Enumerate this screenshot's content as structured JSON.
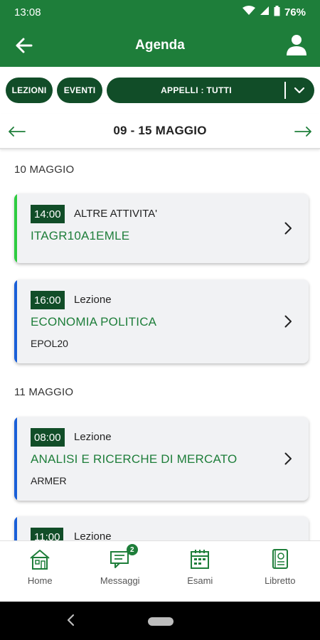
{
  "status": {
    "time": "13:08",
    "battery": "76%"
  },
  "appbar": {
    "title": "Agenda",
    "back_icon": "arrow-left-icon",
    "profile_icon": "user-icon"
  },
  "filters": {
    "lezioni": "LEZIONI",
    "eventi": "EVENTI",
    "appelli": "APPELLI : TUTTI"
  },
  "week": {
    "range": "09 - 15 MAGGIO"
  },
  "days": [
    {
      "label": "10 MAGGIO",
      "events": [
        {
          "time": "14:00",
          "type": "ALTRE ATTIVITA'",
          "name": "ITAGR10A1EMLE",
          "code": "",
          "accent": "#2ecc40"
        },
        {
          "time": "16:00",
          "type": "Lezione",
          "name": "ECONOMIA POLITICA",
          "code": "EPOL20",
          "accent": "#1a5fd8"
        }
      ]
    },
    {
      "label": "11 MAGGIO",
      "events": [
        {
          "time": "08:00",
          "type": "Lezione",
          "name": "ANALISI E RICERCHE DI MERCATO",
          "code": "ARMER",
          "accent": "#1a5fd8"
        },
        {
          "time": "11:00",
          "type": "Lezione",
          "name": "",
          "code": "",
          "accent": "#1a5fd8"
        }
      ]
    }
  ],
  "bottom_nav": [
    {
      "label": "Home",
      "icon": "home-icon"
    },
    {
      "label": "Messaggi",
      "icon": "messages-icon",
      "badge": "2"
    },
    {
      "label": "Esami",
      "icon": "calendar-icon"
    },
    {
      "label": "Libretto",
      "icon": "booklet-icon"
    }
  ],
  "colors": {
    "brand": "#1e7e3a",
    "chip": "#114d28",
    "accent_green": "#2ecc40",
    "accent_blue": "#1a5fd8"
  }
}
